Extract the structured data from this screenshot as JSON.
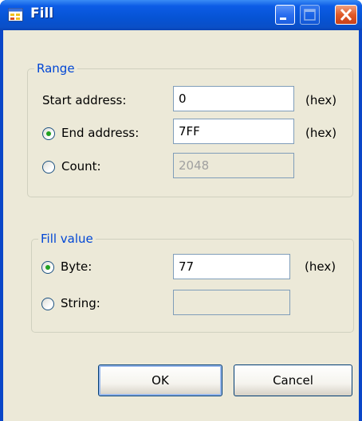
{
  "window": {
    "title": "Fill"
  },
  "range": {
    "legend": "Range",
    "start_address": {
      "label": "Start address:",
      "value": "0",
      "suffix": "(hex)"
    },
    "end_address": {
      "label": "End address:",
      "value": "7FF",
      "suffix": "(hex)",
      "selected": true
    },
    "count": {
      "label": "Count:",
      "value": "2048",
      "selected": false,
      "enabled": false
    }
  },
  "fill_value": {
    "legend": "Fill value",
    "byte": {
      "label": "Byte:",
      "value": "77",
      "suffix": "(hex)",
      "selected": true
    },
    "string": {
      "label": "String:",
      "value": "",
      "selected": false,
      "enabled": false
    }
  },
  "buttons": {
    "ok": "OK",
    "cancel": "Cancel"
  },
  "colors": {
    "titlebar": "#0653d4",
    "dialog_bg": "#ece9d8",
    "group_text": "#0046d5",
    "radio_dot": "#21a121"
  }
}
